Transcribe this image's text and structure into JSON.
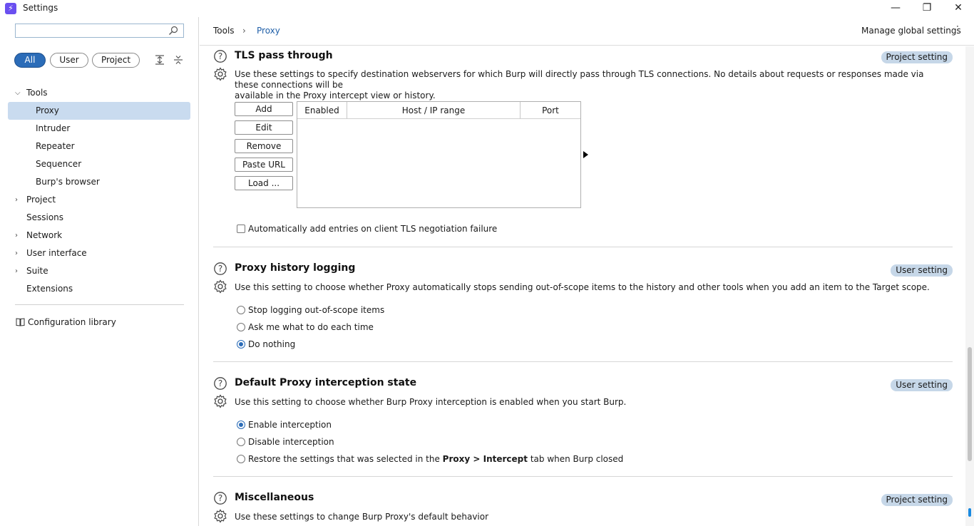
{
  "window": {
    "title": "Settings",
    "icon": "burp-lightning-icon",
    "minimize": "—",
    "restore": "❐",
    "close": "✕"
  },
  "sidebar": {
    "search": {
      "value": "",
      "placeholder": ""
    },
    "filters": [
      "All",
      "User",
      "Project"
    ],
    "active_filter": "All",
    "tree": [
      {
        "label": "Tools",
        "expanded": true,
        "level": 0
      },
      {
        "label": "Proxy",
        "level": 1,
        "selected": true
      },
      {
        "label": "Intruder",
        "level": 1
      },
      {
        "label": "Repeater",
        "level": 1
      },
      {
        "label": "Sequencer",
        "level": 1
      },
      {
        "label": "Burp's browser",
        "level": 1
      },
      {
        "label": "Project",
        "expanded": false,
        "level": 0
      },
      {
        "label": "Sessions",
        "level": 0
      },
      {
        "label": "Network",
        "expanded": false,
        "level": 0
      },
      {
        "label": "User interface",
        "expanded": false,
        "level": 0
      },
      {
        "label": "Suite",
        "expanded": false,
        "level": 0
      },
      {
        "label": "Extensions",
        "level": 0
      }
    ],
    "config_library": "Configuration library"
  },
  "header": {
    "breadcrumb": [
      "Tools",
      "Proxy"
    ],
    "separator": "›",
    "manage_global": "Manage global settings",
    "kebab": "⋮"
  },
  "sections": {
    "tls": {
      "title": "TLS pass through",
      "badge": "Project setting",
      "desc_line1": "Use these settings to specify destination webservers for which Burp will directly pass through TLS connections. No details about requests or responses made via these connections will be",
      "desc_line2": "available in the Proxy intercept view or history.",
      "buttons": [
        "Add",
        "Edit",
        "Remove",
        "Paste URL",
        "Load ..."
      ],
      "columns": [
        "Enabled",
        "Host / IP range",
        "Port"
      ],
      "checkbox_label": "Automatically add entries on client TLS negotiation failure",
      "checkbox_checked": false
    },
    "history": {
      "title": "Proxy history logging",
      "badge": "User setting",
      "desc": "Use this setting to choose whether Proxy automatically stops sending out-of-scope items to the history and other tools when you add an item to the Target scope.",
      "options": [
        "Stop logging out-of-scope items",
        "Ask me what to do each time",
        "Do nothing"
      ],
      "selected": "Do nothing"
    },
    "intercept": {
      "title": "Default Proxy interception state",
      "badge": "User setting",
      "desc": "Use this setting to choose whether Burp Proxy interception is enabled when you start Burp.",
      "opt1": "Enable interception",
      "opt2": "Disable interception",
      "opt3_pre": "Restore the settings that was selected in the ",
      "opt3_b1": "Proxy",
      "opt3_mid": " > ",
      "opt3_b2": "Intercept",
      "opt3_post": " tab when Burp closed",
      "selected": "Enable interception"
    },
    "misc": {
      "title": "Miscellaneous",
      "badge": "Project setting",
      "desc": "Use these settings to change Burp Proxy's default behavior"
    }
  },
  "colors": {
    "accent": "#2b6cb8",
    "selected_bg": "#c9dbef",
    "badge_bg": "#c6d7e8",
    "link": "#1f5fa8"
  }
}
